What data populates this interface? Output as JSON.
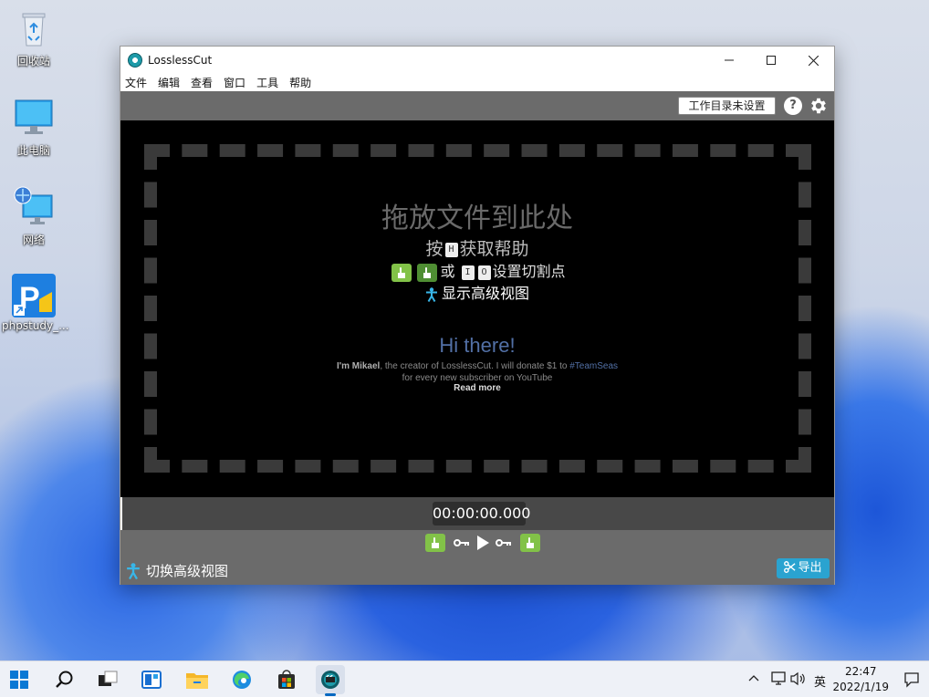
{
  "desktop": {
    "icons": [
      {
        "label": "回收站"
      },
      {
        "label": "此电脑"
      },
      {
        "label": "网络"
      },
      {
        "label": "phpstudy_..."
      }
    ]
  },
  "window": {
    "title": "LosslessCut",
    "menu": [
      "文件",
      "编辑",
      "查看",
      "窗口",
      "工具",
      "帮助"
    ],
    "workdir_label": "工作目录未设置",
    "help_label": "?",
    "drop": {
      "title": "拖放文件到此处",
      "help_prefix": "按",
      "help_key": "H",
      "help_suffix": "获取帮助",
      "cut_or": "或",
      "cut_key_1": "I",
      "cut_key_2": "O",
      "cut_suffix": "设置切割点",
      "advanced": "显示高级视图"
    },
    "promo": {
      "title": "Hi there!",
      "name": "I'm Mikael",
      "text_1": ", the creator of LosslessCut. I will donate $1 to ",
      "tag": "#TeamSeas",
      "text_2": "for every new subscriber on YouTube",
      "read_more": "Read more"
    },
    "timecode": "00:00:00.000",
    "toggle_advanced": "切换高级视图",
    "export_label": "导出"
  },
  "taskbar": {
    "tray_lang": "英",
    "time": "22:47",
    "date": "2022/1/19"
  },
  "colors": {
    "export": "#2aa3d0",
    "segment_green": "#82c248",
    "promo_blue": "#5270a6"
  }
}
